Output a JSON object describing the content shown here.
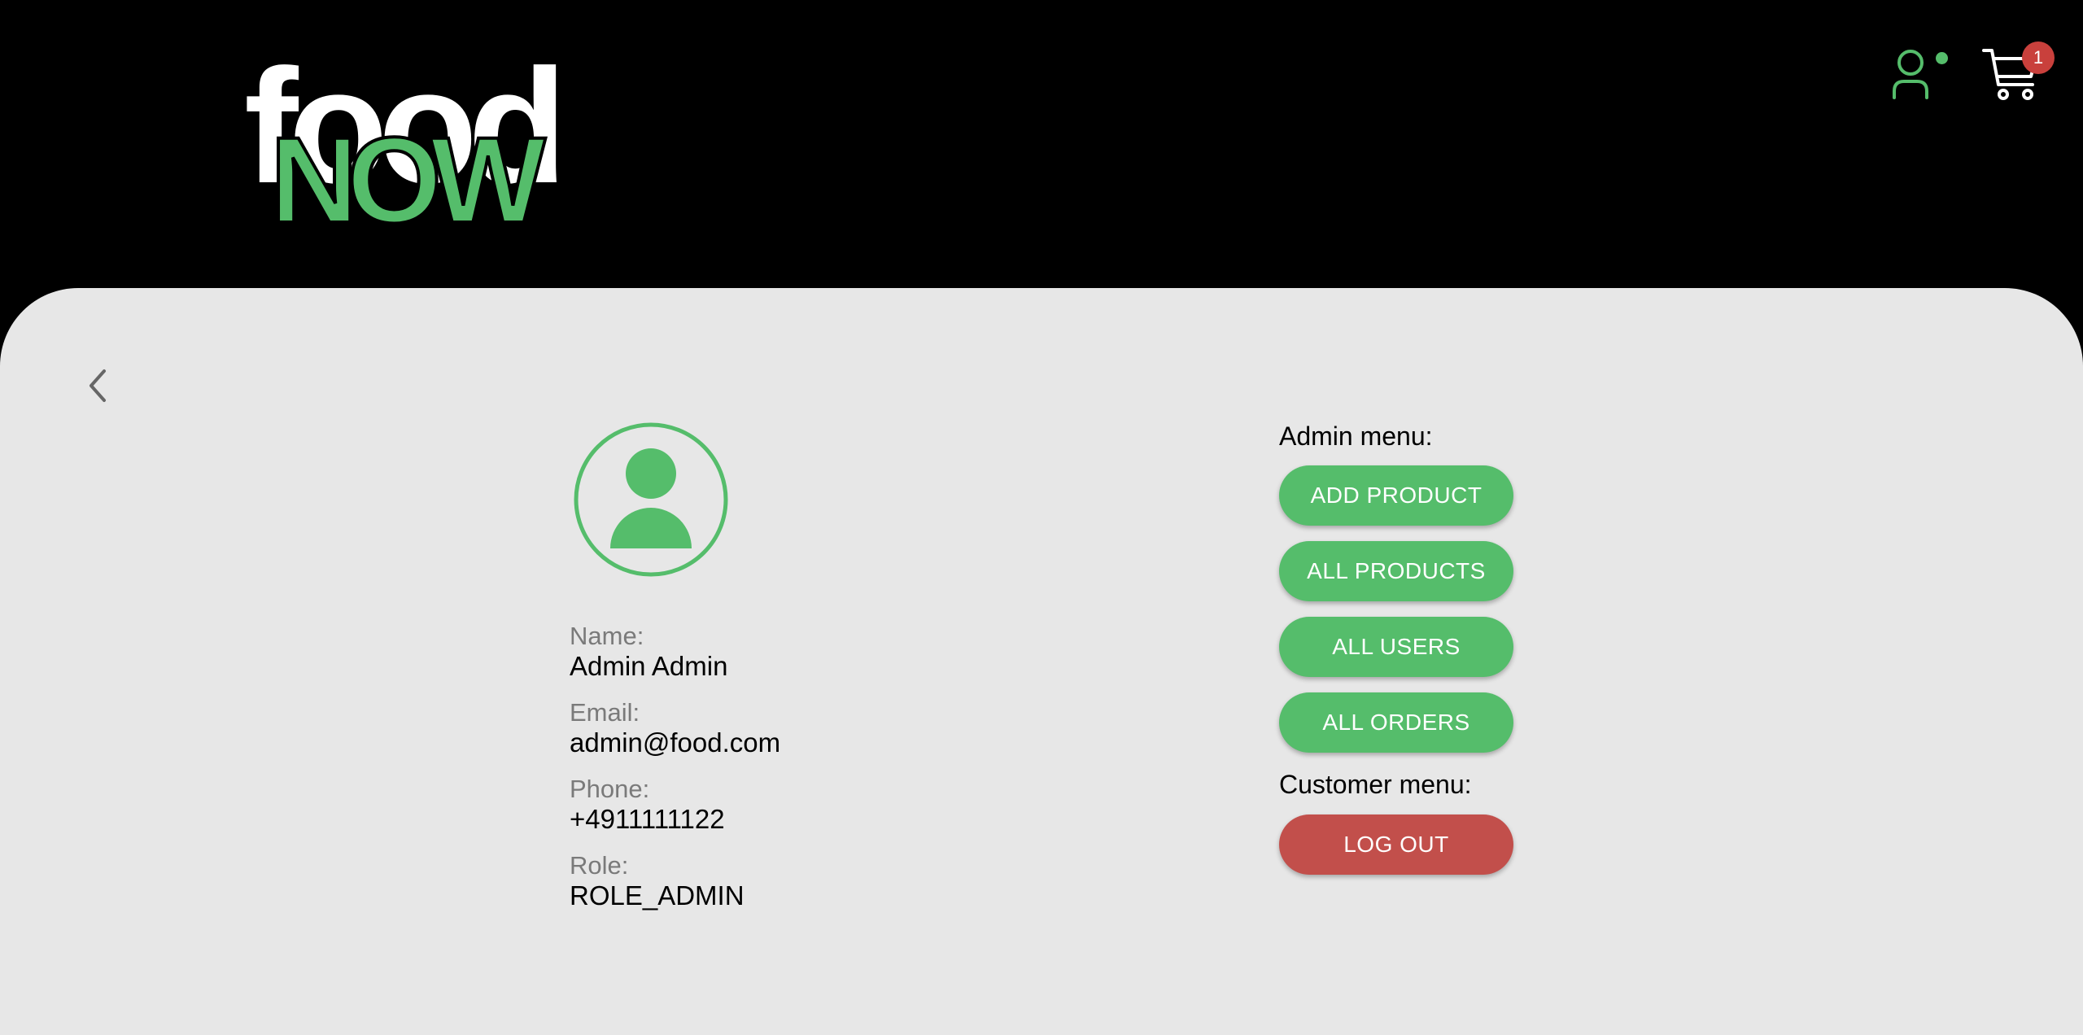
{
  "header": {
    "logo": {
      "line1": "food",
      "line2": "NOW"
    },
    "cart_count": "1",
    "icons": {
      "user": "user-icon",
      "cart": "shopping-cart-icon",
      "back": "chevron-left-icon",
      "avatar": "user-avatar-icon"
    }
  },
  "colors": {
    "brand_green": "#55bd6b",
    "danger_red": "#c24f4b",
    "badge_red": "#c9403c",
    "panel_bg": "#e7e7e7",
    "header_bg": "#000000"
  },
  "profile": {
    "name_label": "Name:",
    "name": "Admin Admin",
    "email_label": "Email:",
    "email": "admin@food.com",
    "phone_label": "Phone:",
    "phone": "+4911111122",
    "role_label": "Role:",
    "role": "ROLE_ADMIN"
  },
  "admin_menu": {
    "title": "Admin menu:",
    "add_product": "ADD PRODUCT",
    "all_products": "ALL PRODUCTS",
    "all_users": "ALL USERS",
    "all_orders": "ALL ORDERS"
  },
  "customer_menu": {
    "title": "Customer menu:",
    "logout": "LOG OUT"
  }
}
